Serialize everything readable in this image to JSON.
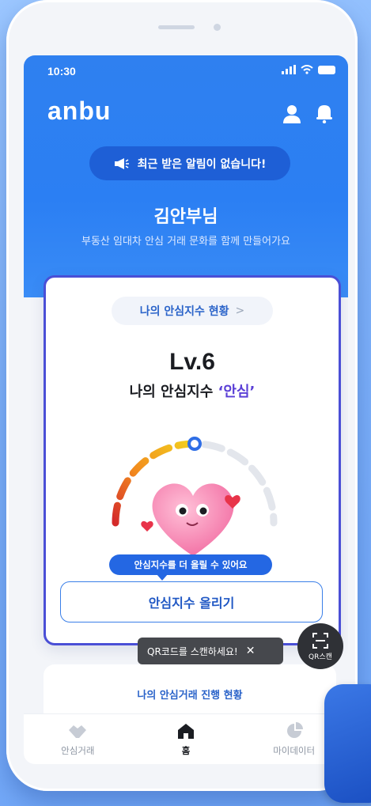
{
  "status": {
    "time": "10:30"
  },
  "app": {
    "logo": "anbu"
  },
  "header": {
    "user_icon": "user-icon",
    "bell_icon": "bell-icon"
  },
  "notice": {
    "text": "최근 받은 알림이 없습니다!",
    "icon": "megaphone-icon"
  },
  "greeting": {
    "name": "김안부님",
    "subtitle": "부동산 임대차 안심 거래 문화를 함께 만들어가요"
  },
  "card": {
    "status_pill": "나의 안심지수 현황",
    "chevron": ">",
    "level": "Lv.6",
    "index_prefix": "나의 안심지수 ",
    "index_value": "‘안심’",
    "gauge_level": 0.5,
    "tooltip": "안심지수를 더 올릴 수 있어요",
    "raise_button": "안심지수 올리기"
  },
  "card2": {
    "title": "나의 안심거래 진행 현황"
  },
  "qr": {
    "hint": "QR코드를 스캔하세요!",
    "close": "✕",
    "label": "QR스캔"
  },
  "tabs": [
    {
      "label": "안심거래",
      "icon": "handshake-icon"
    },
    {
      "label": "홈",
      "icon": "home-icon",
      "active": true
    },
    {
      "label": "마이데이터",
      "icon": "pie-chart-icon"
    }
  ],
  "colors": {
    "primary": "#2b7ff3",
    "accent": "#5a3fd6",
    "card_border": "#4a4fd6"
  }
}
